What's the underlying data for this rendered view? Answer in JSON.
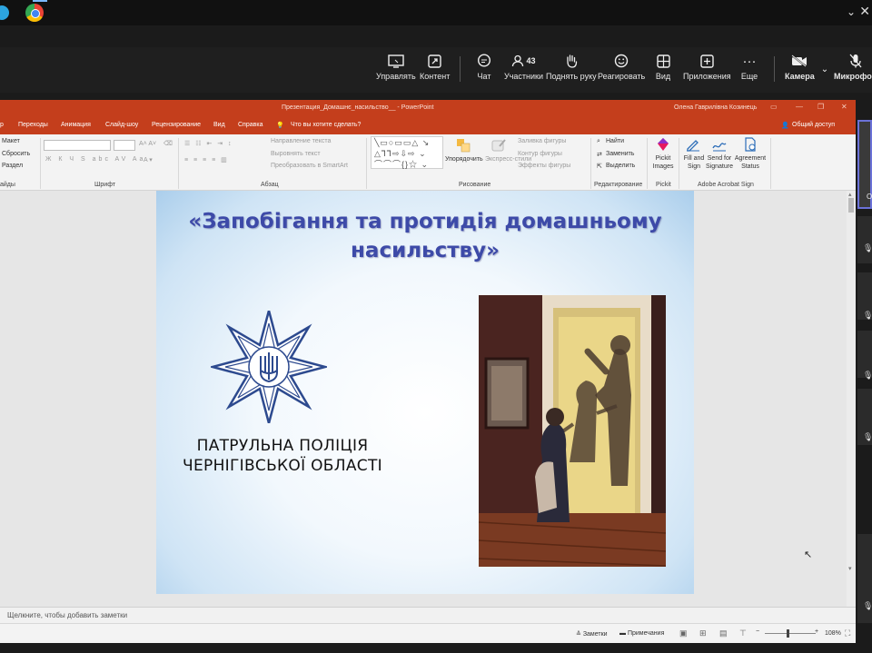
{
  "teams_toolbar": {
    "buttons": [
      {
        "label": "Управлять",
        "icon": "share-screen-icon"
      },
      {
        "label": "Контент",
        "icon": "content-icon"
      },
      {
        "label": "Чат",
        "icon": "chat-icon"
      },
      {
        "label": "Участники",
        "icon": "people-icon",
        "count": "43"
      },
      {
        "label": "Поднять руку",
        "icon": "raise-hand-icon"
      },
      {
        "label": "Реагировать",
        "icon": "react-icon"
      },
      {
        "label": "Вид",
        "icon": "view-icon"
      },
      {
        "label": "Приложения",
        "icon": "apps-icon"
      },
      {
        "label": "Еще",
        "icon": "more-icon"
      },
      {
        "label": "Камера",
        "icon": "camera-off-icon"
      },
      {
        "label": "Микрофон",
        "icon": "mic-off-icon"
      }
    ]
  },
  "powerpoint": {
    "title_bar": {
      "title": "Презентация_Домашнє_насильство__  -  PowerPoint",
      "user": "Олена Гаврилівна Козинець"
    },
    "tabs": [
      "р",
      "Переходы",
      "Анимация",
      "Слайд-шоу",
      "Рецензирование",
      "Вид",
      "Справка"
    ],
    "tell_me": "Что вы хотите сделать?",
    "share": "Общий доступ",
    "ribbon": {
      "slides_group": {
        "layout": "Макет",
        "reset": "Сбросить",
        "section": "Раздел",
        "label": "айды"
      },
      "font_group": {
        "label": "Шрифт"
      },
      "paragraph_group": {
        "text_direction": "Направление текста",
        "align_text": "Выровнять текст",
        "convert_smartart": "Преобразовать в SmartArt",
        "label": "Абзац"
      },
      "drawing_group": {
        "arrange": "Упорядочить",
        "quick_styles": "Экспресс-стили",
        "shape_fill": "Заливка фигуры",
        "shape_outline": "Контур фигуры",
        "shape_effects": "Эффекты фигуры",
        "label": "Рисование"
      },
      "editing_group": {
        "find": "Найти",
        "replace": "Заменить",
        "select": "Выделить",
        "label": "Редактирование"
      },
      "pickit_group": {
        "button": "Pickit Images",
        "label": "Pickit"
      },
      "acrobat_group": {
        "fill_sign": "Fill and Sign",
        "send_signature": "Send for Signature",
        "agreement_status": "Agreement Status",
        "label": "Adobe Acrobat Sign"
      }
    },
    "slide": {
      "title": "«Запобігання та протидія домашньому насильству»",
      "org_line1": "ПАТРУЛЬНА ПОЛІЦІЯ",
      "org_line2": "ЧЕРНІГІВСЬКОЇ ОБЛАСТІ"
    },
    "notes_placeholder": "Щелкните, чтобы добавить заметки",
    "status_bar": {
      "notes": "Заметки",
      "comments": "Примечания",
      "zoom": "108%",
      "minus": "−",
      "plus": "+"
    }
  }
}
